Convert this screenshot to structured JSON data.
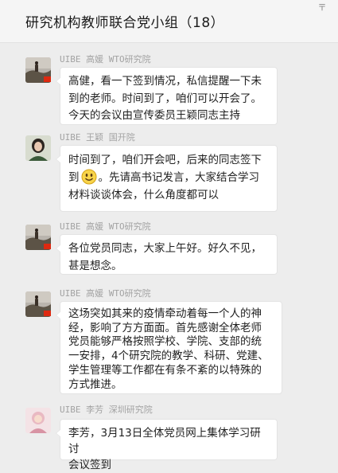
{
  "window": {
    "title": "研究机构教师联合党小组（18）",
    "pin_icon": "pin-icon",
    "pin_glyph": "〒"
  },
  "colors": {
    "background": "#ededed",
    "bubble": "#ffffff",
    "sender_text": "#a3a3a3",
    "flag": "#de2910"
  },
  "messages": [
    {
      "sender": "UIBE 高媛 WTO研究院",
      "avatar": "avatar-scenery",
      "lines": [
        "高健，看一下签到情况，私信提醒一下未",
        "到的老师。时间到了，咱们可以开会了。",
        "今天的会议由宣传委员王颖同志主持"
      ]
    },
    {
      "sender": "UIBE 王颖 国开院",
      "avatar": "avatar-portrait",
      "lines": [
        "时间到了，咱们开会吧，后来的同志签下"
      ],
      "line2_pre": "到",
      "emoji": "smile-emoji",
      "line2_post": "。先请高书记发言，大家结合学习",
      "line3": "材料谈谈体会，什么角度都可以"
    },
    {
      "sender": "UIBE 高媛 WTO研究院",
      "avatar": "avatar-scenery",
      "lines": [
        "各位党员同志，大家上午好。好久不见，",
        "甚是想念。"
      ]
    },
    {
      "sender": "UIBE 高媛 WTO研究院",
      "avatar": "avatar-scenery",
      "lines": [
        "这场突如其来的疫情牵动着每一个人的神",
        "经，影响了方方面面。首先感谢全体老师",
        "党员能够严格按照学校、学院、支部的统",
        "一安排，4个研究院的教学、科研、党建、",
        "学生管理等工作都在有条不紊的以特殊的",
        "方式推进。"
      ]
    },
    {
      "sender": "UIBE 李芳 深圳研究院",
      "avatar": "avatar-pink",
      "lines": [
        "李芳，3月13日全体党员网上集体学习研讨",
        "会议签到"
      ]
    }
  ]
}
